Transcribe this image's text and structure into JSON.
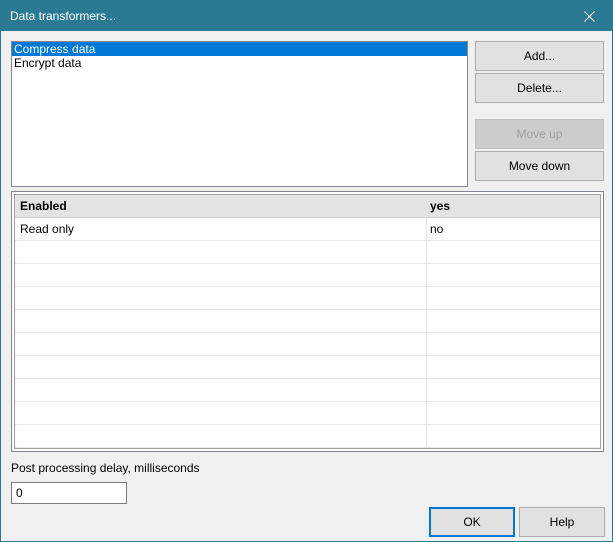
{
  "window": {
    "title": "Data transformers..."
  },
  "transformers": {
    "items": [
      {
        "label": "Compress data",
        "selected": true
      },
      {
        "label": "Encrypt data",
        "selected": false
      }
    ]
  },
  "buttons": {
    "add": "Add...",
    "delete": "Delete...",
    "move_up": "Move up",
    "move_down": "Move down",
    "ok": "OK",
    "help": "Help"
  },
  "properties": {
    "header": {
      "name": "Enabled",
      "value": "yes"
    },
    "rows": [
      {
        "name": "Read only",
        "value": "no"
      }
    ]
  },
  "delay": {
    "label": "Post processing delay, milliseconds",
    "value": "0"
  },
  "colors": {
    "titlebar": "#2b7a94",
    "selection": "#0078d7"
  }
}
